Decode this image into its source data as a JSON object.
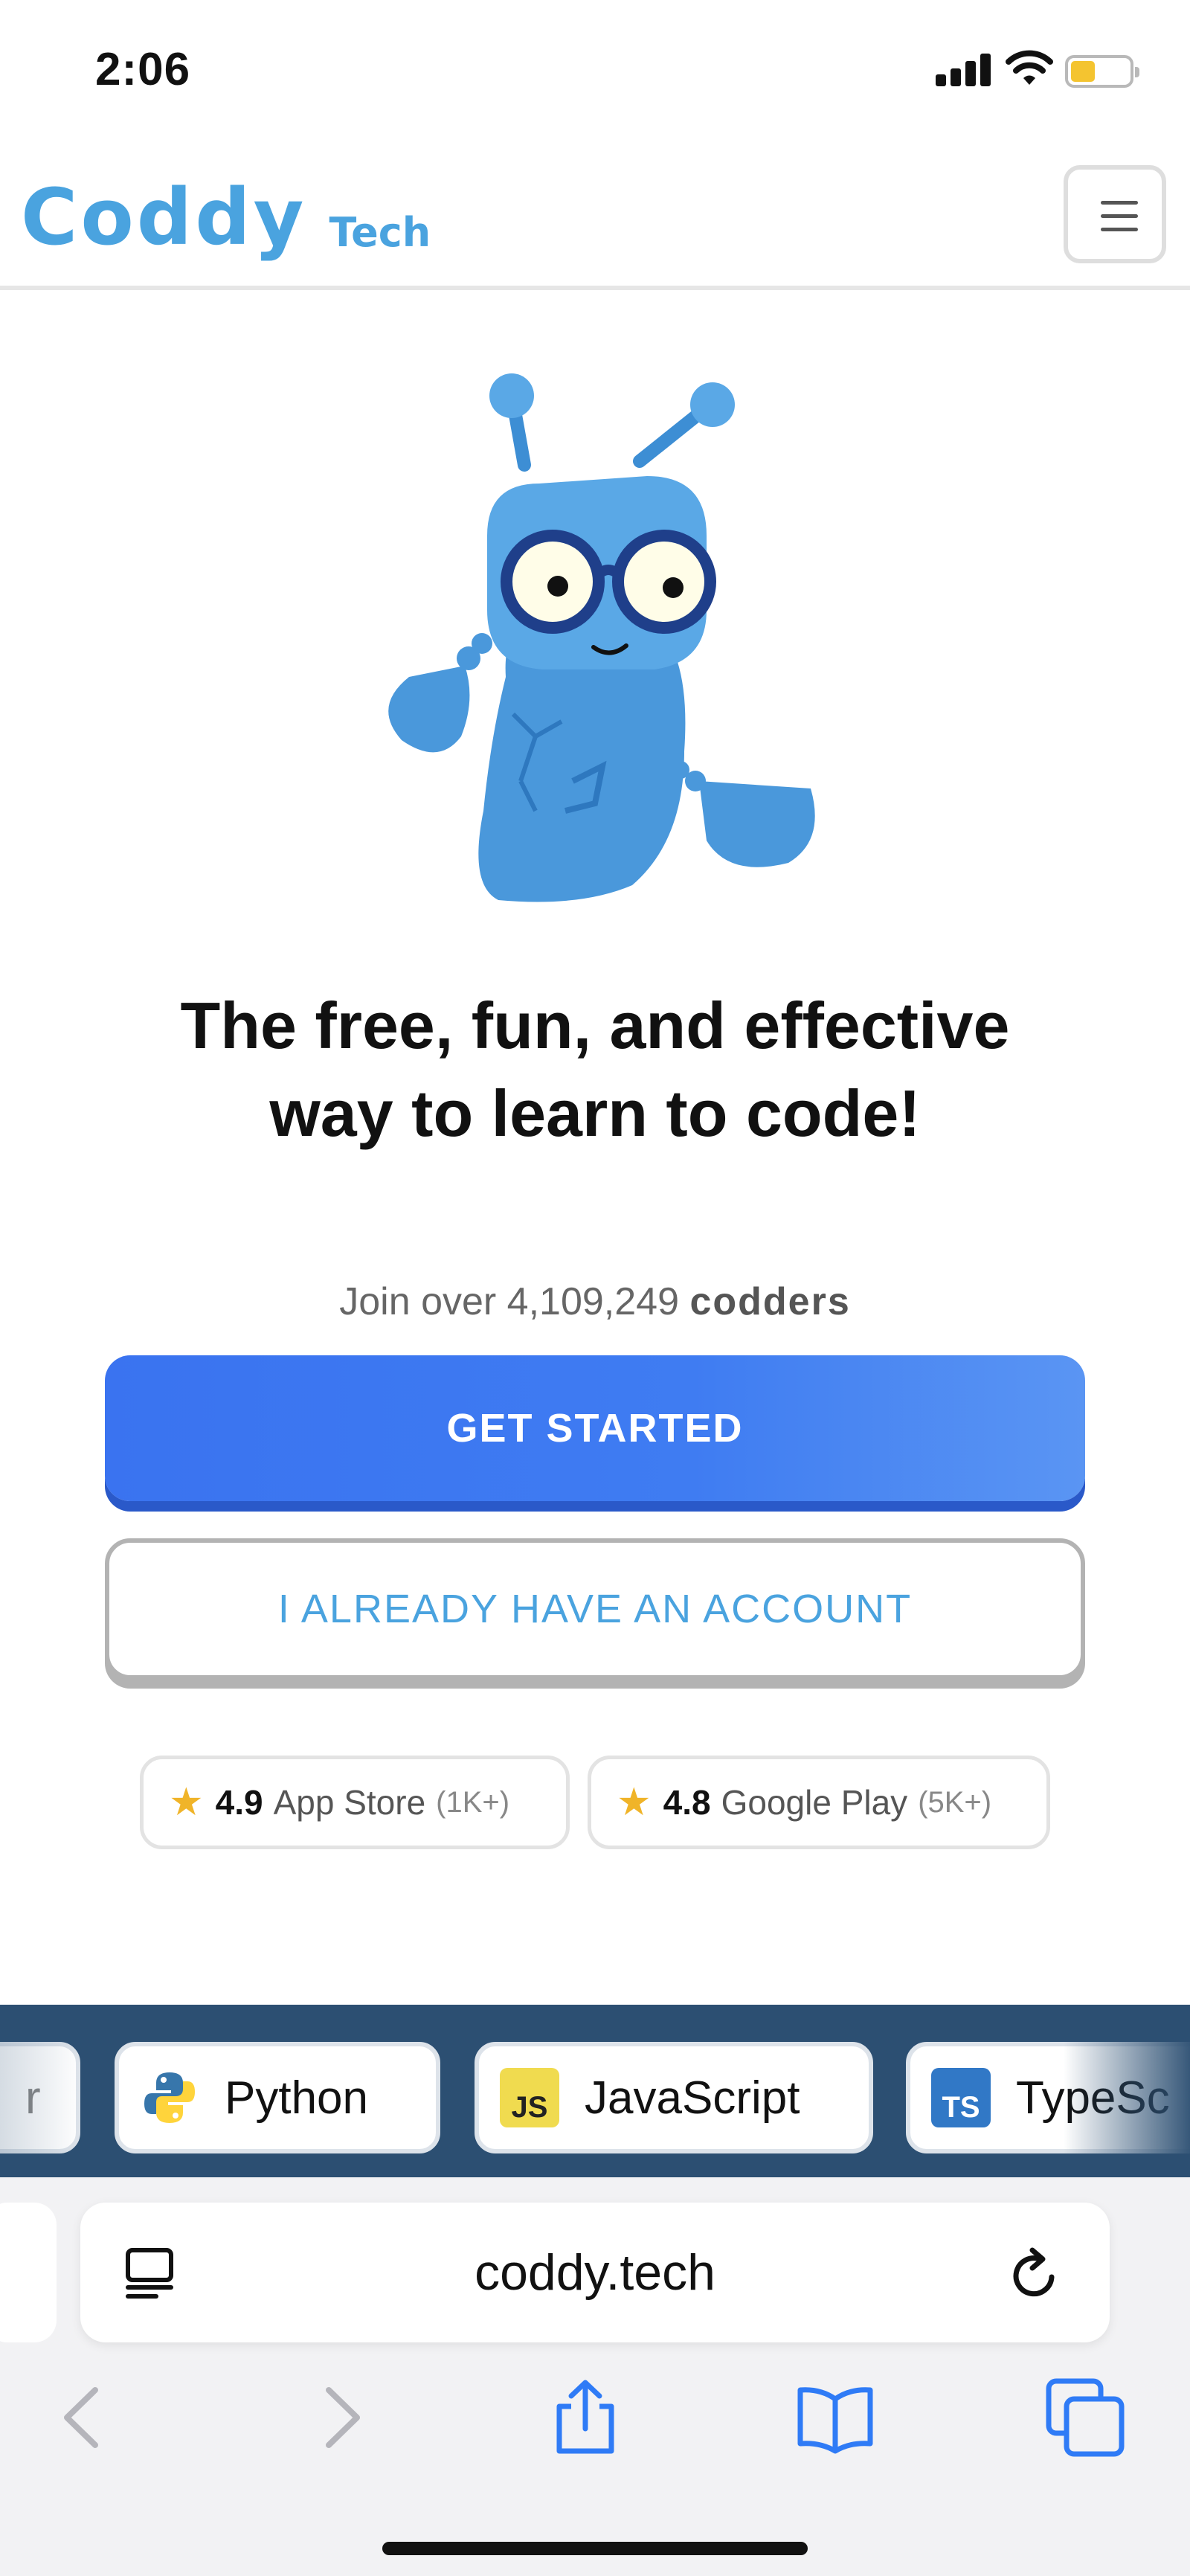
{
  "status_bar": {
    "time": "2:06",
    "icons": [
      "cellular-signal-icon",
      "wifi-icon",
      "battery-icon"
    ],
    "battery_color": "#f4c430"
  },
  "header": {
    "logo_main": "Coddy",
    "logo_sub": "Tech",
    "menu_icon": "hamburger-menu-icon",
    "brand_color": "#4aa3df"
  },
  "hero": {
    "mascot": "robot-mascot-illustration",
    "headline_line1": "The free, fun, and effective",
    "headline_line2": "way to learn to code!",
    "join_prefix": "Join over 4,109,249",
    "join_suffix": "codders"
  },
  "actions": {
    "get_started": "GET STARTED",
    "have_account": "I ALREADY HAVE AN ACCOUNT",
    "primary_color": "#3a73f0"
  },
  "ratings": [
    {
      "score": "4.9",
      "store": "App Store",
      "count": "(1K+)"
    },
    {
      "score": "4.8",
      "store": "Google Play",
      "count": "(5K+)"
    }
  ],
  "languages": [
    {
      "label": "r"
    },
    {
      "label": "Python",
      "icon": "python-icon"
    },
    {
      "label": "JavaScript",
      "icon": "javascript-icon",
      "badge": "JS"
    },
    {
      "label": "TypeSc",
      "icon": "typescript-icon",
      "badge": "TS"
    }
  ],
  "browser": {
    "url": "coddy.tech",
    "toolbar": [
      "back-icon",
      "forward-icon",
      "share-icon",
      "bookmarks-icon",
      "tabs-icon"
    ]
  }
}
